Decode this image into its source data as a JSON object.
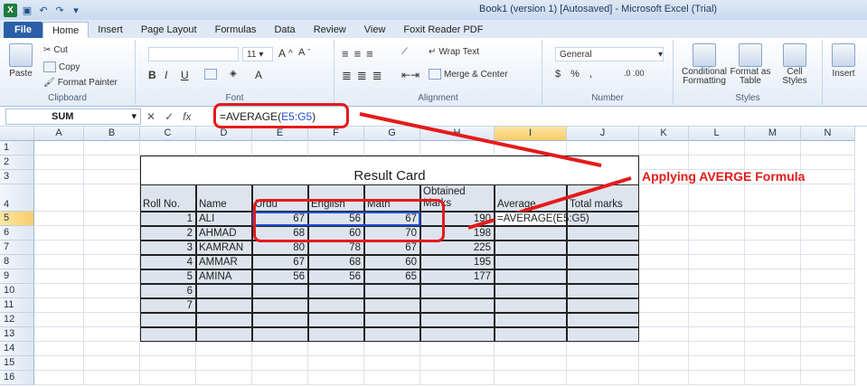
{
  "window": {
    "title": "Book1 (version 1) [Autosaved] - Microsoft Excel (Trial)",
    "app_icon": "X"
  },
  "tabs": [
    "File",
    "Home",
    "Insert",
    "Page Layout",
    "Formulas",
    "Data",
    "Review",
    "View",
    "Foxit Reader PDF"
  ],
  "ribbon": {
    "clipboard": {
      "paste": "Paste",
      "cut": "Cut",
      "copy": "Copy",
      "format_painter": "Format Painter",
      "label": "Clipboard"
    },
    "font": {
      "size": "11",
      "label": "Font"
    },
    "alignment": {
      "wrap_text": "Wrap Text",
      "merge_center": "Merge & Center",
      "label": "Alignment"
    },
    "number": {
      "format": "General",
      "label": "Number"
    },
    "styles": {
      "conditional": "Conditional Formatting",
      "format_table": "Format as Table",
      "cell_styles": "Cell Styles",
      "label": "Styles"
    },
    "cells": {
      "insert": "Insert"
    }
  },
  "formula_bar": {
    "name_box": "SUM",
    "formula_prefix": "=AVERAGE(",
    "formula_ref": "E5:G5",
    "formula_suffix": ")"
  },
  "columns": [
    "A",
    "B",
    "C",
    "D",
    "E",
    "F",
    "G",
    "H",
    "I",
    "J",
    "K",
    "L",
    "M",
    "N"
  ],
  "rows": [
    "1",
    "2",
    "3",
    "4",
    "5",
    "6",
    "7",
    "8",
    "9",
    "10",
    "11",
    "12",
    "13",
    "14",
    "15",
    "16"
  ],
  "sheet": {
    "title": "Result Card",
    "headers": {
      "roll": "Roll No.",
      "name": "Name",
      "urdu": "Urdu",
      "english": "English",
      "math": "Math",
      "obtained": "Obtained Marks",
      "average": "Average",
      "total": "Total marks"
    },
    "data_rows": [
      {
        "roll": "1",
        "name": "ALI",
        "urdu": "67",
        "english": "56",
        "math": "67",
        "obtained": "190",
        "average": "=AVERAGE(E5:G5)"
      },
      {
        "roll": "2",
        "name": "AHMAD",
        "urdu": "68",
        "english": "60",
        "math": "70",
        "obtained": "198",
        "average": ""
      },
      {
        "roll": "3",
        "name": "KAMRAN",
        "urdu": "80",
        "english": "78",
        "math": "67",
        "obtained": "225",
        "average": ""
      },
      {
        "roll": "4",
        "name": "AMMAR",
        "urdu": "67",
        "english": "68",
        "math": "60",
        "obtained": "195",
        "average": ""
      },
      {
        "roll": "5",
        "name": "AMINA",
        "urdu": "56",
        "english": "56",
        "math": "65",
        "obtained": "177",
        "average": ""
      },
      {
        "roll": "6",
        "name": "",
        "urdu": "",
        "english": "",
        "math": "",
        "obtained": "",
        "average": ""
      },
      {
        "roll": "7",
        "name": "",
        "urdu": "",
        "english": "",
        "math": "",
        "obtained": "",
        "average": ""
      },
      {
        "roll": "",
        "name": "",
        "urdu": "",
        "english": "",
        "math": "",
        "obtained": "",
        "average": ""
      },
      {
        "roll": "",
        "name": "",
        "urdu": "",
        "english": "",
        "math": "",
        "obtained": "",
        "average": ""
      }
    ]
  },
  "annotation": {
    "text": "Applying AVERGE Formula",
    "color": "#e51a1a"
  }
}
